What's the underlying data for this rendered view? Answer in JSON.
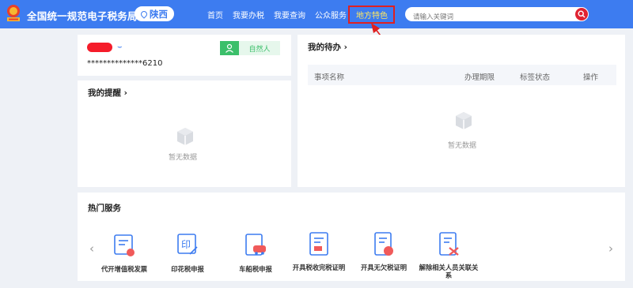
{
  "header": {
    "site_title": "全国统一规范电子税务局",
    "region": "陕西",
    "nav": [
      {
        "label": "首页"
      },
      {
        "label": "我要办税"
      },
      {
        "label": "我要查询"
      },
      {
        "label": "公众服务"
      },
      {
        "label": "地方特色"
      }
    ],
    "search_placeholder": "请输入关键词"
  },
  "user": {
    "account_masked": "**************6210",
    "type_label": "自然人"
  },
  "reminders": {
    "title": "我的提醒 ›",
    "empty_text": "暂无数据"
  },
  "todos": {
    "title": "我的待办 ›",
    "columns": [
      "事项名称",
      "办理期限",
      "标签状态",
      "操作"
    ],
    "empty_text": "暂无数据"
  },
  "services": {
    "title": "热门服务",
    "items": [
      {
        "label": "代开增值税发票",
        "icon": "invoice-icon"
      },
      {
        "label": "印花税申报",
        "icon": "stamp-tax-icon"
      },
      {
        "label": "车船税申报",
        "icon": "vehicle-tax-icon"
      },
      {
        "label": "开具税收完税证明",
        "icon": "tax-certificate-icon"
      },
      {
        "label": "开具无欠税证明",
        "icon": "no-arrears-certificate-icon"
      },
      {
        "label": "解除相关人员关联关系",
        "icon": "remove-relation-icon"
      }
    ]
  },
  "colors": {
    "header_bg": "#3d7cf0",
    "accent": "#3d7cf0",
    "annotation_red": "#e02020",
    "user_type_green": "#3bbf6a"
  }
}
